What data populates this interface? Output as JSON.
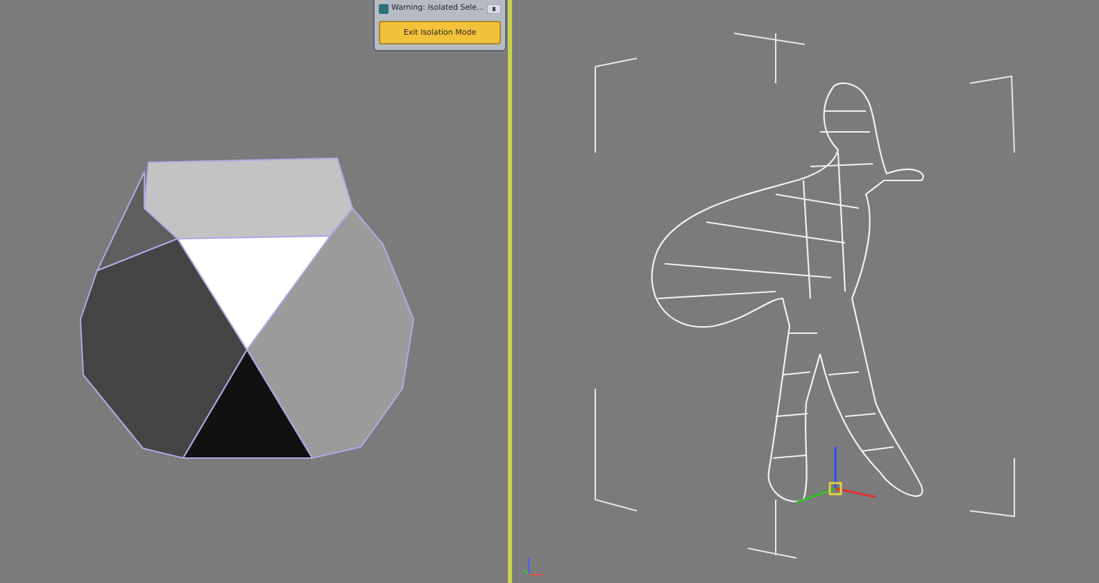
{
  "isolation_dialog": {
    "title": "Warning: Isolated Sele...",
    "button": "Exit Isolation Mode"
  }
}
